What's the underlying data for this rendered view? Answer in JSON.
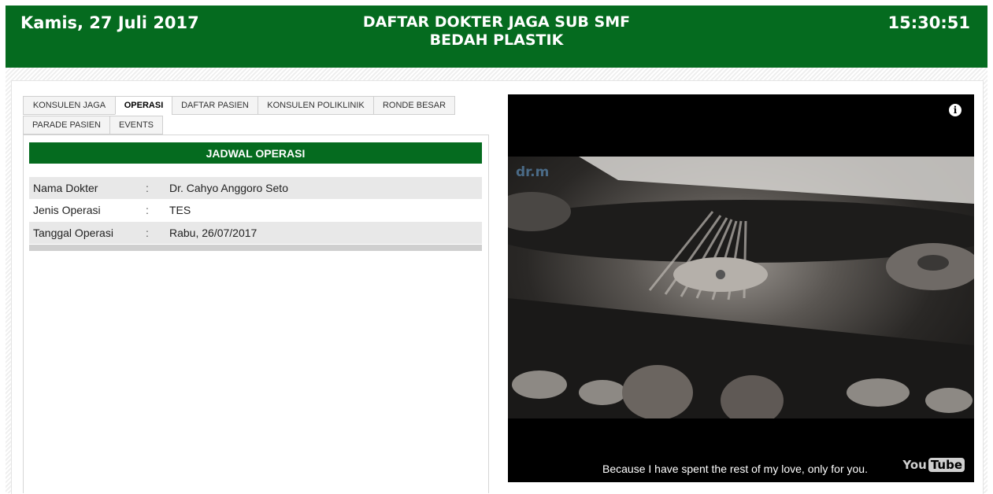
{
  "header": {
    "date": "Kamis, 27 Juli 2017",
    "title_line1": "DAFTAR DOKTER JAGA SUB SMF",
    "title_line2": "BEDAH PLASTIK",
    "clock": "15:30:51",
    "brand_color": "#056b1f"
  },
  "tabs": [
    {
      "label": "KONSULEN JAGA",
      "active": false
    },
    {
      "label": "OPERASI",
      "active": true
    },
    {
      "label": "DAFTAR PASIEN",
      "active": false
    },
    {
      "label": "KONSULEN POLIKLINIK",
      "active": false
    },
    {
      "label": "RONDE BESAR",
      "active": false
    },
    {
      "label": "PARADE PASIEN",
      "active": false
    },
    {
      "label": "EVENTS",
      "active": false
    }
  ],
  "section": {
    "title": "JADWAL OPERASI",
    "separator": ":",
    "rows": [
      {
        "label": "Nama Dokter",
        "value": "Dr. Cahyo Anggoro Seto"
      },
      {
        "label": "Jenis Operasi",
        "value": "TES"
      },
      {
        "label": "Tanggal Operasi",
        "value": "Rabu, 26/07/2017"
      }
    ]
  },
  "video": {
    "watermark": "dr.m",
    "info_icon": "info-icon",
    "subtitle": "Because I have spent the rest of my love, only for you.",
    "logo_you": "You",
    "logo_tube": "Tube"
  }
}
